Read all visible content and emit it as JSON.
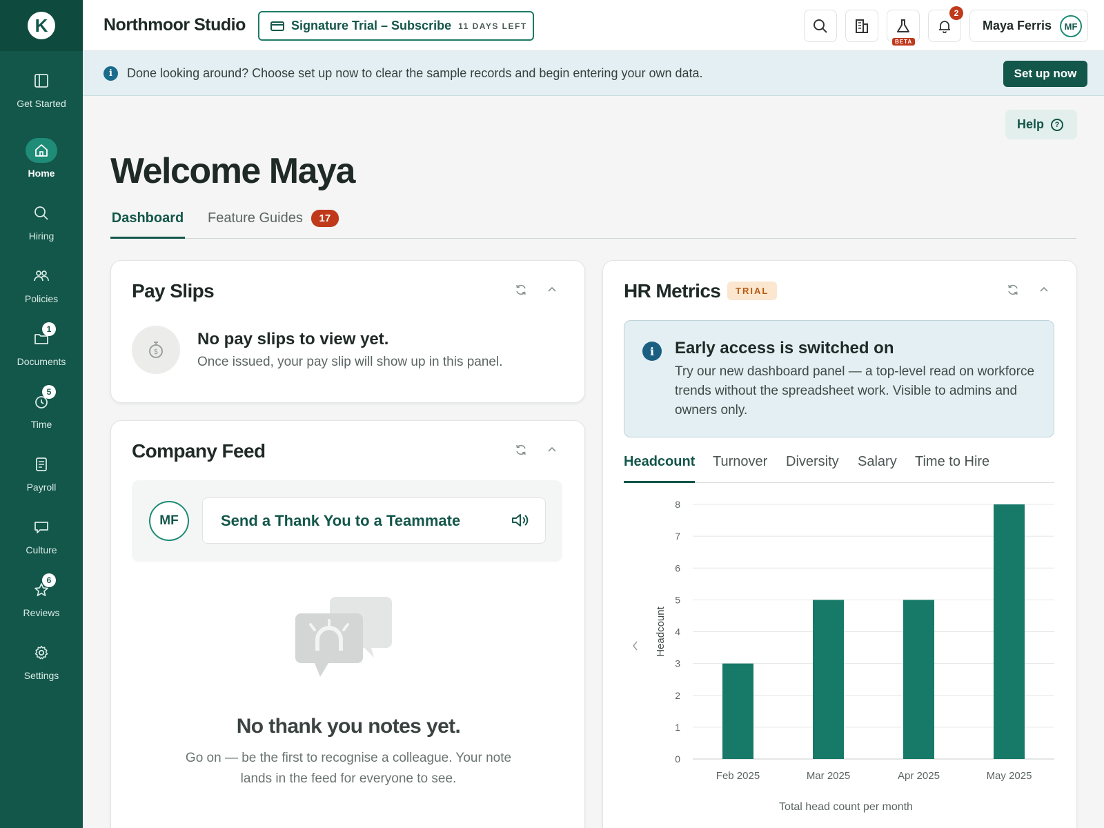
{
  "app": {
    "logo_letter": "K",
    "org_name": "Northmoor Studio",
    "trial_label": "Signature Trial – Subscribe",
    "trial_days": "11 DAYS LEFT",
    "beta_label": "BETA",
    "notification_count": "2",
    "user_name": "Maya Ferris",
    "user_initials": "MF"
  },
  "sidebar": {
    "items": [
      {
        "label": "Get Started",
        "icon": "panel-icon",
        "active": false,
        "badge": ""
      },
      {
        "label": "Home",
        "icon": "home-icon",
        "active": true,
        "badge": ""
      },
      {
        "label": "Hiring",
        "icon": "search-icon",
        "active": false,
        "badge": ""
      },
      {
        "label": "Policies",
        "icon": "people-icon",
        "active": false,
        "badge": ""
      },
      {
        "label": "Documents",
        "icon": "folder-icon",
        "active": false,
        "badge": "1"
      },
      {
        "label": "Time",
        "icon": "clock-icon",
        "active": false,
        "badge": "5"
      },
      {
        "label": "Payroll",
        "icon": "document-icon",
        "active": false,
        "badge": ""
      },
      {
        "label": "Culture",
        "icon": "chat-icon",
        "active": false,
        "badge": ""
      },
      {
        "label": "Reviews",
        "icon": "star-icon",
        "active": false,
        "badge": "6"
      },
      {
        "label": "Settings",
        "icon": "gear-icon",
        "active": false,
        "badge": ""
      }
    ]
  },
  "banner": {
    "text": "Done looking around? Choose set up now to clear the sample records and begin entering your own data.",
    "button": "Set up now"
  },
  "main": {
    "help_label": "Help",
    "welcome": "Welcome Maya",
    "tabs": [
      {
        "label": "Dashboard",
        "active": true
      },
      {
        "label": "Feature Guides",
        "count": "17"
      }
    ]
  },
  "payslips": {
    "title": "Pay Slips",
    "empty_head": "No pay slips to view yet.",
    "empty_sub": "Once issued, your pay slip will show up in this panel."
  },
  "feed": {
    "title": "Company Feed",
    "avatar": "MF",
    "cta": "Send a Thank You to a Teammate",
    "empty_head": "No thank you notes yet.",
    "empty_sub": "Go on — be the first to recognise a colleague. Your note lands in the feed for everyone to see."
  },
  "hr": {
    "title": "HR Metrics",
    "badge": "TRIAL",
    "early_head": "Early access is switched on",
    "early_body": "Try our new dashboard panel — a top-level read on workforce trends without the spreadsheet work. Visible to admins and owners only.",
    "tabs": [
      "Headcount",
      "Turnover",
      "Diversity",
      "Salary",
      "Time to Hire"
    ],
    "active_tab": "Headcount"
  },
  "colors": {
    "brand": "#13564a",
    "bar": "#177a68",
    "alert": "#c0391b"
  },
  "chart_data": {
    "type": "bar",
    "categories": [
      "Feb 2025",
      "Mar 2025",
      "Apr 2025",
      "May 2025"
    ],
    "values": [
      3,
      5,
      5,
      8
    ],
    "ylabel": "Headcount",
    "xlabel": "Total head count per month",
    "ylim": [
      0,
      8
    ],
    "yticks": [
      0,
      1,
      2,
      3,
      4,
      5,
      6,
      7,
      8
    ],
    "grid": true
  }
}
